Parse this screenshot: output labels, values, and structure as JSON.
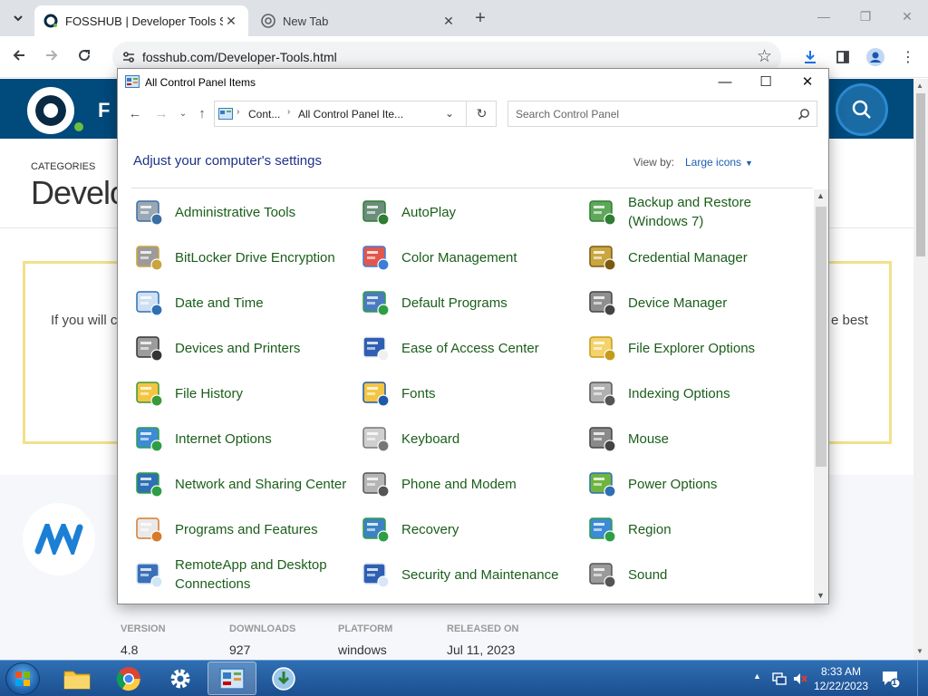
{
  "browser": {
    "tabs": [
      {
        "title": "FOSSHUB | Developer Tools Sof",
        "active": true
      },
      {
        "title": "New Tab",
        "active": false
      }
    ],
    "url": "fosshub.com/Developer-Tools.html"
  },
  "site": {
    "logo_letters": "F",
    "categories_label": "CATEGORIES",
    "page_title": "Develo",
    "box_text_left": "If you will c",
    "box_text_right": "e best",
    "meta": {
      "version_label": "VERSION",
      "version_value": "4.8",
      "downloads_label": "DOWNLOADS",
      "downloads_value": "927",
      "platform_label": "PLATFORM",
      "platform_value": "windows",
      "released_label": "RELEASED ON",
      "released_value": "Jul 11, 2023"
    }
  },
  "control_panel": {
    "window_title": "All Control Panel Items",
    "address": {
      "crumb1": "Cont...",
      "crumb2": "All Control Panel Ite..."
    },
    "search_placeholder": "Search Control Panel",
    "heading": "Adjust your computer's settings",
    "view_by_label": "View by:",
    "view_by_value": "Large icons",
    "items": [
      {
        "label": "Administrative Tools",
        "icon": "admin-tools-icon"
      },
      {
        "label": "AutoPlay",
        "icon": "autoplay-icon"
      },
      {
        "label": "Backup and Restore (Windows 7)",
        "icon": "backup-restore-icon"
      },
      {
        "label": "BitLocker Drive Encryption",
        "icon": "bitlocker-icon"
      },
      {
        "label": "Color Management",
        "icon": "color-management-icon"
      },
      {
        "label": "Credential Manager",
        "icon": "credential-manager-icon"
      },
      {
        "label": "Date and Time",
        "icon": "date-time-icon"
      },
      {
        "label": "Default Programs",
        "icon": "default-programs-icon"
      },
      {
        "label": "Device Manager",
        "icon": "device-manager-icon"
      },
      {
        "label": "Devices and Printers",
        "icon": "devices-printers-icon"
      },
      {
        "label": "Ease of Access Center",
        "icon": "ease-of-access-icon"
      },
      {
        "label": "File Explorer Options",
        "icon": "file-explorer-options-icon"
      },
      {
        "label": "File History",
        "icon": "file-history-icon"
      },
      {
        "label": "Fonts",
        "icon": "fonts-icon"
      },
      {
        "label": "Indexing Options",
        "icon": "indexing-options-icon"
      },
      {
        "label": "Internet Options",
        "icon": "internet-options-icon"
      },
      {
        "label": "Keyboard",
        "icon": "keyboard-icon"
      },
      {
        "label": "Mouse",
        "icon": "mouse-icon"
      },
      {
        "label": "Network and Sharing Center",
        "icon": "network-sharing-icon"
      },
      {
        "label": "Phone and Modem",
        "icon": "phone-modem-icon"
      },
      {
        "label": "Power Options",
        "icon": "power-options-icon"
      },
      {
        "label": "Programs and Features",
        "icon": "programs-features-icon"
      },
      {
        "label": "Recovery",
        "icon": "recovery-icon"
      },
      {
        "label": "Region",
        "icon": "region-icon"
      },
      {
        "label": "RemoteApp and Desktop Connections",
        "icon": "remoteapp-icon"
      },
      {
        "label": "Security and Maintenance",
        "icon": "security-maintenance-icon"
      },
      {
        "label": "Sound",
        "icon": "sound-icon"
      }
    ]
  },
  "taskbar": {
    "time": "8:33 AM",
    "date": "12/22/2023",
    "notification_count": "1"
  }
}
